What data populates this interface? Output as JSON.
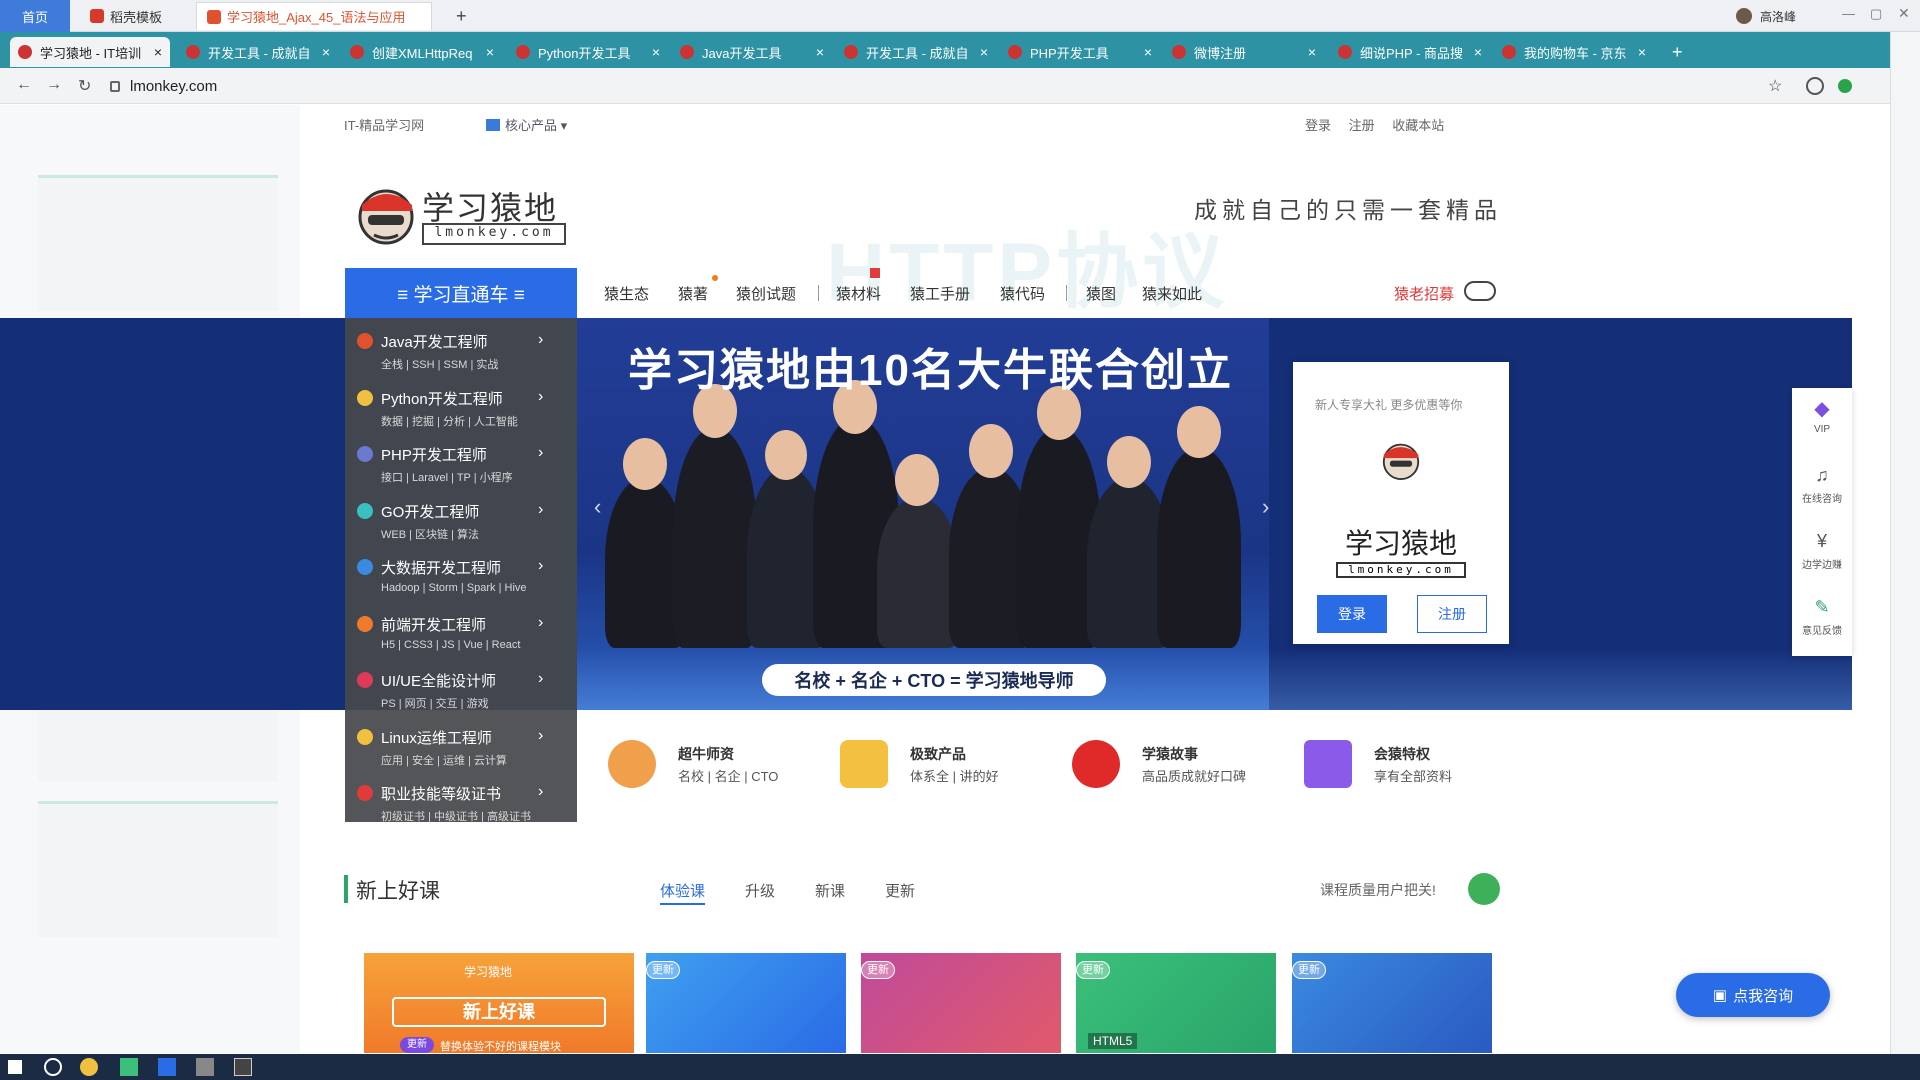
{
  "outer": {
    "home": "首页",
    "tab_template": "稻壳模板",
    "tab_doc": "学习猿地_Ajax_45_语法与应用"
  },
  "browser_tabs": [
    {
      "label": "学习猿地 - IT培训",
      "active": true
    },
    {
      "label": "开发工具 - 成就自",
      "active": false
    },
    {
      "label": "创建XMLHttpReq",
      "active": false
    },
    {
      "label": "Python开发工具",
      "active": false
    },
    {
      "label": "Java开发工具",
      "active": false
    },
    {
      "label": "开发工具 - 成就自",
      "active": false
    },
    {
      "label": "PHP开发工具",
      "active": false
    },
    {
      "label": "微博注册",
      "active": false
    },
    {
      "label": "细说PHP - 商品搜",
      "active": false
    },
    {
      "label": "我的购物车 - 京东",
      "active": false
    }
  ],
  "user_name": "高洛峰",
  "address": {
    "url": "lmonkey.com"
  },
  "site": {
    "topbar_left": "IT-精品学习网",
    "topbar_products": "核心产品",
    "topbar_right": [
      "登录",
      "注册",
      "收藏本站"
    ],
    "logo_text": "学习猿地",
    "logo_domain": "lmonkey.com",
    "slogan": "成就自己的只需一套精品",
    "watermark": "HTTP协议",
    "nav_button": "≡ 学习直通车 ≡",
    "nav_items": [
      "猿生态",
      "猿著",
      "猿创试题",
      "猿材料",
      "猿工手册",
      "猿代码",
      "猿图",
      "猿来如此"
    ],
    "recruit": "猿老招募",
    "banner_title": "学习猿地由10名大牛联合创立",
    "banner_pill": "名校 + 名企 + CTO  = 学习猿地导师",
    "login_card": {
      "tip": "新人专享大礼 更多优惠等你",
      "logo_text": "学习猿地",
      "logo_domain": "lmonkey.com",
      "login": "登录",
      "register": "注册"
    },
    "menu": [
      {
        "title": "Java开发工程师",
        "sub": "全栈 | SSH | SSM | 实战"
      },
      {
        "title": "Python开发工程师",
        "sub": "数据 | 挖掘 | 分析 | 人工智能"
      },
      {
        "title": "PHP开发工程师",
        "sub": "接口 | Laravel | TP | 小程序"
      },
      {
        "title": "GO开发工程师",
        "sub": "WEB | 区块链 | 算法"
      },
      {
        "title": "大数据开发工程师",
        "sub": "Hadoop | Storm | Spark | Hive"
      },
      {
        "title": "前端开发工程师",
        "sub": "H5 | CSS3 | JS | Vue | React"
      },
      {
        "title": "UI/UE全能设计师",
        "sub": "PS | 网页  | 交互  | 游戏"
      },
      {
        "title": "Linux运维工程师",
        "sub": "应用 | 安全  | 运维 | 云计算"
      },
      {
        "title": "职业技能等级证书",
        "sub": "初级证书 | 中级证书 | 高级证书"
      }
    ],
    "float_panel": [
      "VIP",
      "在线咨询",
      "边学边赚",
      "意见反馈"
    ],
    "features": [
      {
        "title": "超牛师资",
        "sub": "名校 | 名企 | CTO"
      },
      {
        "title": "极致产品",
        "sub": "体系全 | 讲的好"
      },
      {
        "title": "学猿故事",
        "sub": "高品质成就好口碑"
      },
      {
        "title": "会猿特权",
        "sub": "享有全部资料"
      }
    ],
    "new_courses": {
      "title": "新上好课",
      "tabs": [
        "体验课",
        "升级",
        "新课",
        "更新"
      ],
      "note": "课程质量用户把关!",
      "card1_title": "新上好课",
      "card1_badge": "更新",
      "card1_sub": "替换体验不好的课程模块",
      "update_badge": "更新",
      "html5_label": "HTML5"
    },
    "consult": "点我咨询"
  },
  "colors": {
    "accent": "#2a6be6",
    "tabbar": "#2d92a4",
    "menu_bg": "#46484c",
    "banner": "#142e78",
    "recruit": "#e03a3a"
  }
}
